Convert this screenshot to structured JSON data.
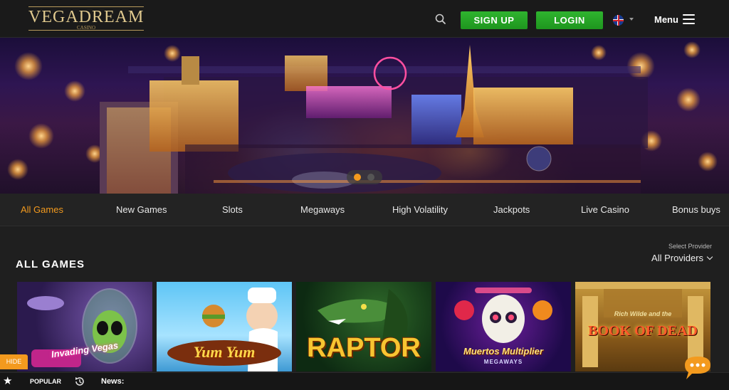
{
  "brand": {
    "logo_text": "VEGADREAM",
    "logo_sub": "CASINO"
  },
  "header": {
    "signup_label": "SIGN UP",
    "login_label": "LOGIN",
    "menu_label": "Menu",
    "language_icon": "uk-flag-icon"
  },
  "colors": {
    "accent": "#f39a1e",
    "button_green": "#22a822",
    "logo_gold": "#e0c98e",
    "background": "#1f1f1f"
  },
  "hero": {
    "slides": 2,
    "active_slide": 1
  },
  "categories": [
    {
      "label": "All Games",
      "active": true
    },
    {
      "label": "New Games",
      "active": false
    },
    {
      "label": "Slots",
      "active": false
    },
    {
      "label": "Megaways",
      "active": false
    },
    {
      "label": "High Volatility",
      "active": false
    },
    {
      "label": "Jackpots",
      "active": false
    },
    {
      "label": "Live Casino",
      "active": false
    },
    {
      "label": "Bonus buys",
      "active": false
    }
  ],
  "games_section": {
    "title": "ALL GAMES",
    "provider_label": "Select Provider",
    "provider_value": "All Providers",
    "games": [
      {
        "name": "Invading Vegas",
        "art_text": "Invading Vegas"
      },
      {
        "name": "Yum Yum",
        "art_text": "Yum Yum"
      },
      {
        "name": "Raptor",
        "art_text": "RAPTOR"
      },
      {
        "name": "Muertos Multiplier Megaways",
        "art_text": "Muertos Multiplier",
        "art_sub": "MEGAWAYS"
      },
      {
        "name": "Book of Dead",
        "art_text": "BOOK OF DEAD",
        "art_sub": "Rich Wilde and the"
      }
    ]
  },
  "bottom_bar": {
    "hide_label": "HIDE",
    "popular_label": "POPULAR",
    "news_label": "News:"
  }
}
